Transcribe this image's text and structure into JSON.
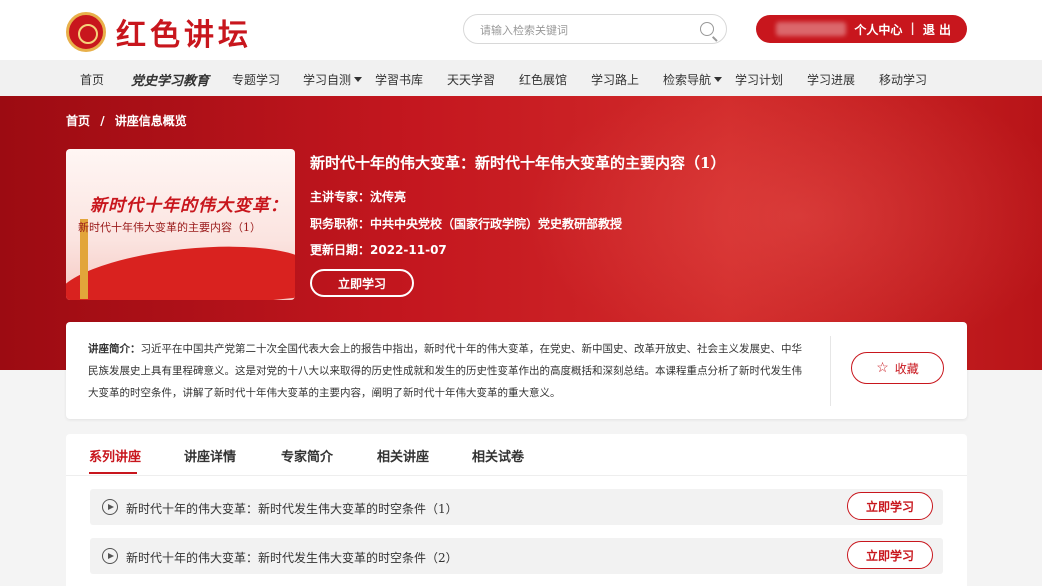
{
  "header": {
    "logo_text": "红色讲坛",
    "search_placeholder": "请输入检索关键词",
    "user_center": "个人中心",
    "separator": "|",
    "logout": "退 出"
  },
  "nav": {
    "items": [
      {
        "label": "首页"
      },
      {
        "label": "党史学习教育"
      },
      {
        "label": "专题学习"
      },
      {
        "label": "学习自测"
      },
      {
        "label": "学習书库"
      },
      {
        "label": "天天学習"
      },
      {
        "label": "红色展馆"
      },
      {
        "label": "学习路上"
      },
      {
        "label": "检索导航"
      },
      {
        "label": "学习计划"
      },
      {
        "label": "学习进展"
      },
      {
        "label": "移动学习"
      }
    ]
  },
  "breadcrumb": {
    "home": "首页",
    "sep": "/",
    "current": "讲座信息概览"
  },
  "course": {
    "cover_title": "新时代十年的伟大变革：",
    "cover_subtitle": "新时代十年伟大变革的主要内容（1）",
    "title": "新时代十年的伟大变革：新时代十年伟大变革的主要内容（1）",
    "expert_label": "主讲专家：",
    "expert": "沈传亮",
    "position_label": "职务职称：",
    "position": "中共中央党校（国家行政学院）党史教研部教授",
    "date_label": "更新日期：",
    "date": "2022-11-07",
    "study_button": "立即学习"
  },
  "intro": {
    "label": "讲座简介：",
    "text": "习近平在中国共产党第二十次全国代表大会上的报告中指出，新时代十年的伟大变革，在党史、新中国史、改革开放史、社会主义发展史、中华民族发展史上具有里程碑意义。这是对党的十八大以来取得的历史性成就和发生的历史性变革作出的高度概括和深刻总结。本课程重点分析了新时代发生伟大变革的时空条件，讲解了新时代十年伟大变革的主要内容，阐明了新时代十年伟大变革的重大意义。",
    "favorite": "收藏"
  },
  "tabs": [
    {
      "label": "系列讲座"
    },
    {
      "label": "讲座详情"
    },
    {
      "label": "专家简介"
    },
    {
      "label": "相关讲座"
    },
    {
      "label": "相关试卷"
    }
  ],
  "series": [
    {
      "title": "新时代十年的伟大变革：新时代发生伟大变革的时空条件（1）",
      "button": "立即学习"
    },
    {
      "title": "新时代十年的伟大变革：新时代发生伟大变革的时空条件（2）",
      "button": "立即学习"
    }
  ],
  "colors": {
    "accent": "#c8161d"
  }
}
